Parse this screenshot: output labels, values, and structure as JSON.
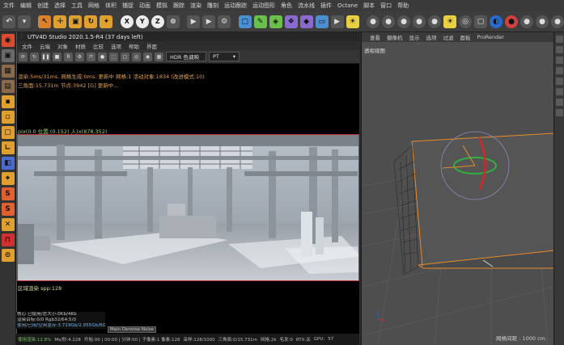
{
  "menubar": {
    "items": [
      "文件",
      "编辑",
      "创建",
      "选择",
      "工具",
      "网格",
      "体积",
      "捕捉",
      "动画",
      "模拟",
      "跟踪",
      "渲染",
      "雕刻",
      "运动跟踪",
      "运动图形",
      "角色",
      "流水线",
      "插件",
      "Octane",
      "脚本",
      "窗口",
      "帮助"
    ]
  },
  "main_toolbar": {
    "xyz": [
      "X",
      "Y",
      "Z"
    ]
  },
  "render_window": {
    "title": "UTV4D Studio 2020.1.5-R4 (37 days left)",
    "menu": [
      "文件",
      "云端",
      "对象",
      "材质",
      "比较",
      "选项",
      "帮助",
      "界面"
    ],
    "hdr_select": "HDR 色调映",
    "pt_select": "PT",
    "stats_line1": "渲染:5ms/31ms. 网格生成:0ms. 更新中 网格:1 活动对象:1834 (改进模式:10)",
    "stats_line2": "三角面:15.731m 节点:3942 [G] 更新中...",
    "pixel_info": "pix(0.0 位置:(0.152) 人)x(878.352)",
    "region_text": "区域渲染 spp:128",
    "status_lines": [
      "核心 已使用/总大小:0Kb/4Kb",
      "渲染目标:0/0          Rgb32/64:5/0",
      "使用/已用/空闲显存:3.719Gb/2.955Gb/8Gb"
    ],
    "denoise_button": "Main Denoise Noise",
    "bottom_stats": [
      "使用渲染:12.8%",
      "Ms/秒:4.228",
      "开始:00 | 00:00 | 分钟:00 | 子像素:1 像素:128",
      "采样:128/1000",
      "三角面:0/15.731m",
      "网格:2k",
      "毛发:0",
      "RTX:关",
      "GPU:",
      "57"
    ]
  },
  "viewport": {
    "menu": [
      "查看",
      "摄像机",
      "显示",
      "选项",
      "过滤",
      "面板",
      "ProRender"
    ],
    "label": "透视视图",
    "scale": "网格间距 : 1000 cm"
  },
  "colors": {
    "render_border": "#c03030",
    "stats_text": "#e0a050",
    "pixel_text": "#9fd07a",
    "region_text": "#d8d8a0",
    "selection_orange": "#e88b2a"
  }
}
